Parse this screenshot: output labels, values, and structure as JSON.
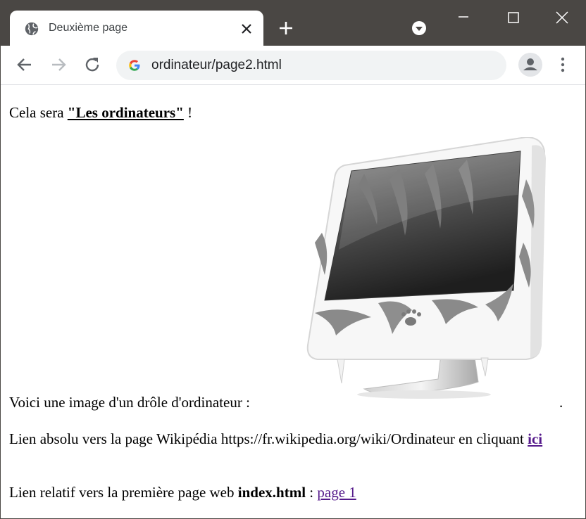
{
  "browser": {
    "tab": {
      "title": "Deuxième page",
      "icon": "globe-icon"
    },
    "address_bar": {
      "url": "ordinateur/page2.html"
    }
  },
  "page": {
    "p1": {
      "before": "Cela sera ",
      "link": "\"Les ordinateurs\"",
      "after": " !"
    },
    "p2": {
      "text": "Voici une image d'un drôle d'ordinateur :",
      "end": ".",
      "image": "computer-illustration"
    },
    "p3": {
      "text": "Lien absolu vers la page Wikipédia https://fr.wikipedia.org/wiki/Ordinateur en cliquant ",
      "link": "ici"
    },
    "p4": {
      "text": "Lien relatif vers la première page web ",
      "strong": "index.html",
      "sep": " : ",
      "link": "page 1"
    }
  },
  "colors": {
    "tabbar": "#4a4744",
    "visited_link": "#551a8b",
    "omnibox": "#f1f3f4"
  }
}
